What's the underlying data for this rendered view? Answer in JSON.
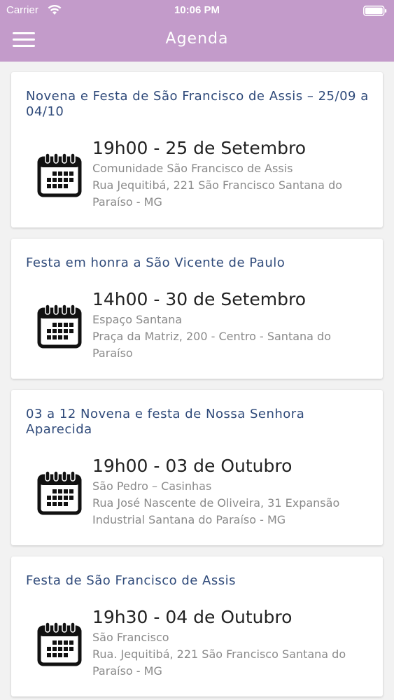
{
  "status": {
    "carrier": "Carrier",
    "time": "10:06 PM"
  },
  "header": {
    "title": "Agenda"
  },
  "colors": {
    "header_bg": "#c39bca",
    "title_blue": "#2f4a7a",
    "muted": "#8a8a8a"
  },
  "icons": {
    "menu": "hamburger-menu-icon",
    "event": "calendar-icon"
  },
  "events": [
    {
      "title": "Novena e Festa de São Francisco de Assis – 25/09 a 04/10",
      "time": "19h00 - 25 de Setembro",
      "place": "Comunidade São Francisco de Assis",
      "address": "Rua Jequitibá, 221 São Francisco Santana do Paraíso - MG"
    },
    {
      "title": "Festa em honra a São Vicente de Paulo",
      "time": "14h00 - 30 de Setembro",
      "place": "Espaço Santana",
      "address": "Praça da Matriz, 200 - Centro - Santana do Paraíso"
    },
    {
      "title": "03 a 12 Novena e festa de Nossa Senhora Aparecida",
      "time": "19h00 - 03 de Outubro",
      "place": "São Pedro – Casinhas",
      "address": "Rua José Nascente de Oliveira, 31 Expansão Industrial Santana do Paraíso - MG"
    },
    {
      "title": "Festa de São Francisco de Assis",
      "time": "19h30 - 04 de Outubro",
      "place": "São Francisco",
      "address": "Rua. Jequitibá, 221 São Francisco Santana do Paraíso - MG"
    }
  ]
}
